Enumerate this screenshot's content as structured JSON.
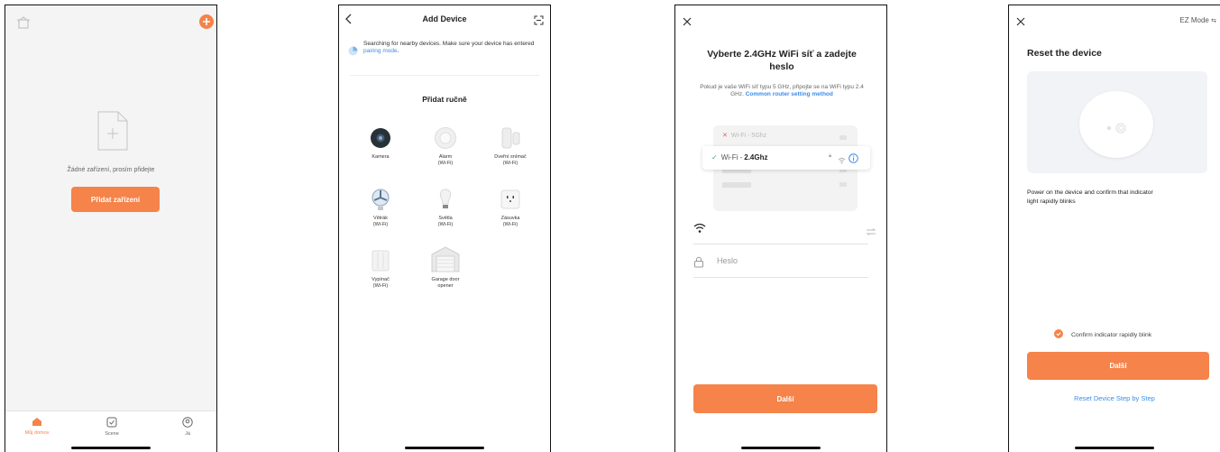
{
  "screen1": {
    "empty_text": "Žádné zařízení, prosím přidejte",
    "add_button": "Přidat zařízení",
    "tabs": [
      {
        "label": "Můj domov",
        "icon": "home-icon"
      },
      {
        "label": "Scene",
        "icon": "scene-icon"
      },
      {
        "label": "Já",
        "icon": "profile-icon"
      }
    ],
    "accent": "#f5834a"
  },
  "screen2": {
    "title": "Add Device",
    "searching_text": "Searching for nearby devices. Make sure your device has entered",
    "pairing_link": "pairing mode",
    "section_title": "Přidat ručně",
    "devices": [
      {
        "label": "Kamera",
        "icon": "camera-icon"
      },
      {
        "label": "Alarm\n(Wi-Fi)",
        "icon": "alarm-icon"
      },
      {
        "label": "Dveřní snímač\n(Wi-Fi)",
        "icon": "door-sensor-icon"
      },
      {
        "label": "Větrák\n(Wi-Fi)",
        "icon": "fan-icon"
      },
      {
        "label": "Světla\n(Wi-Fi)",
        "icon": "bulb-icon"
      },
      {
        "label": "Zásuvka\n(Wi-Fi)",
        "icon": "socket-icon"
      },
      {
        "label": "Vypínač\n(Wi-Fi)",
        "icon": "switch-icon"
      },
      {
        "label": "Garage door\nopener",
        "icon": "garage-icon"
      }
    ]
  },
  "screen3": {
    "title": "Vyberte 2.4GHz WiFi síť a zadejte heslo",
    "hint": "Pokud je vaše WiFi síť typu 5 GHz, připojte se na WiFi typu 2.4 GHz.",
    "hint_link": "Common router setting method",
    "wifi_5g": "Wi-Fi - 5Ghz",
    "wifi_24_prefix": "Wi-Fi - ",
    "wifi_24_bold": "2.4Ghz",
    "password_placeholder": "Heslo",
    "next_button": "Další"
  },
  "screen4": {
    "mode": "EZ Mode",
    "title": "Reset the device",
    "instruction": "Power on the device and confirm that indicator light rapidly blinks",
    "confirm_label": "Confirm indicator rapidly blink",
    "next_button": "Další",
    "step_link": "Reset Device Step by Step",
    "link_color": "#3d8be8"
  }
}
